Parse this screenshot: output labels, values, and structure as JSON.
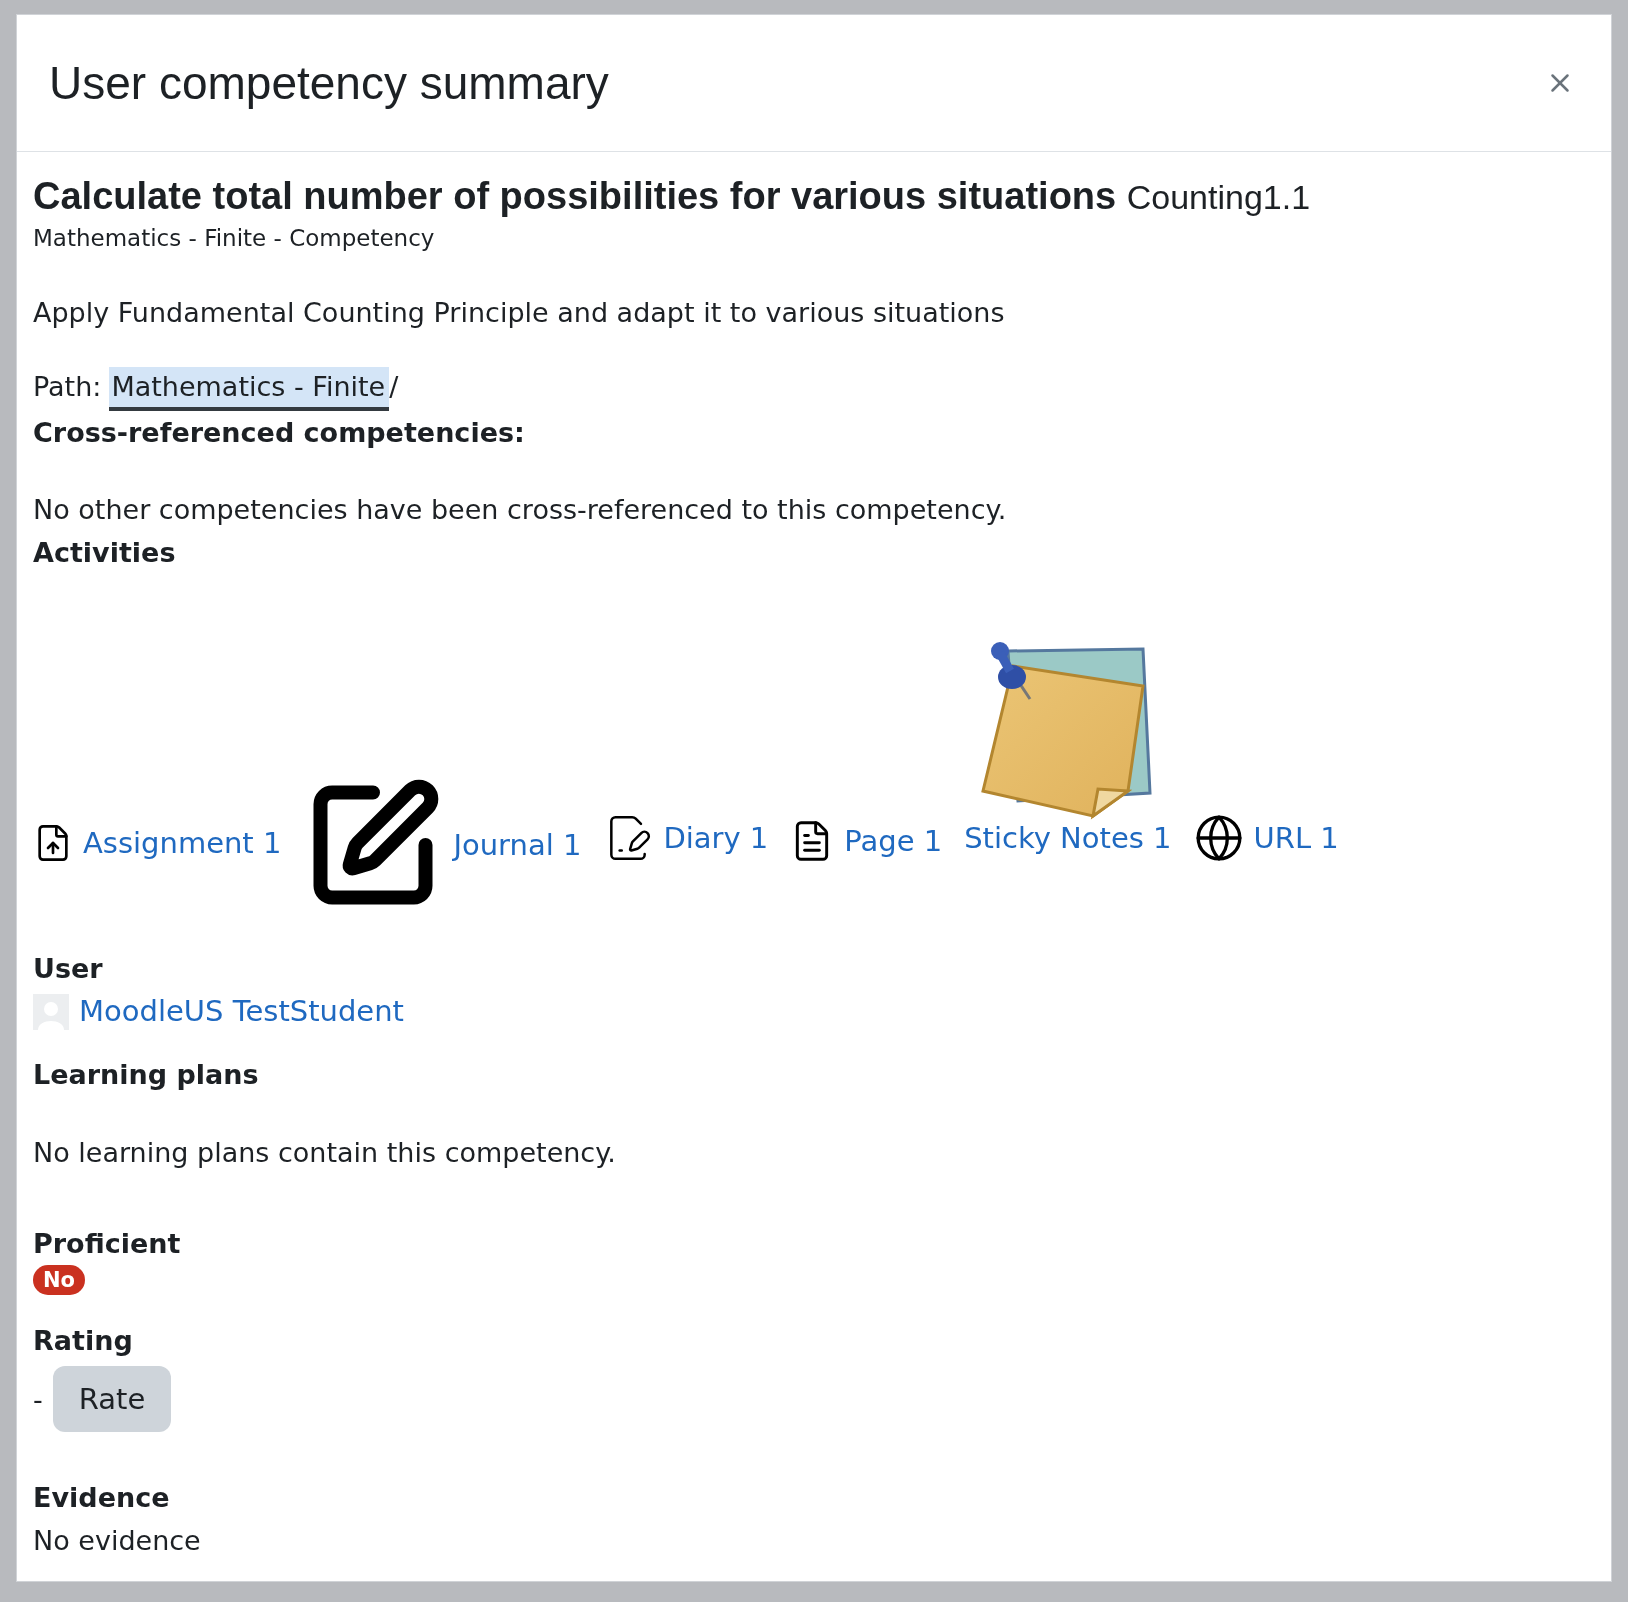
{
  "dialog": {
    "title": "User competency summary"
  },
  "competency": {
    "name": "Calculate total number of possibilities for various situations",
    "idnumber": "Counting1.1",
    "framework": "Mathematics - Finite - Competency",
    "description": "Apply Fundamental Counting Principle and adapt it to various situations",
    "path_label": "Path:",
    "path_link": "Mathematics - Finite",
    "path_separator": "/"
  },
  "cross_referenced": {
    "heading": "Cross-referenced competencies:",
    "text": "No other competencies have been cross-referenced to this competency."
  },
  "activities": {
    "heading": "Activities",
    "items": [
      {
        "kind": "assignment",
        "label": "Assignment 1"
      },
      {
        "kind": "journal",
        "label": "Journal 1"
      },
      {
        "kind": "diary",
        "label": "Diary 1"
      },
      {
        "kind": "page",
        "label": "Page 1"
      },
      {
        "kind": "sticky",
        "label": "Sticky Notes 1"
      },
      {
        "kind": "url",
        "label": "URL 1"
      }
    ]
  },
  "user": {
    "heading": "User",
    "name": "MoodleUS TestStudent"
  },
  "learning_plans": {
    "heading": "Learning plans",
    "text": "No learning plans contain this competency."
  },
  "proficient": {
    "heading": "Proficient",
    "label": "No",
    "proficient": false
  },
  "rating": {
    "heading": "Rating",
    "value": "-",
    "button": "Rate"
  },
  "evidence": {
    "heading": "Evidence",
    "text": "No evidence"
  }
}
